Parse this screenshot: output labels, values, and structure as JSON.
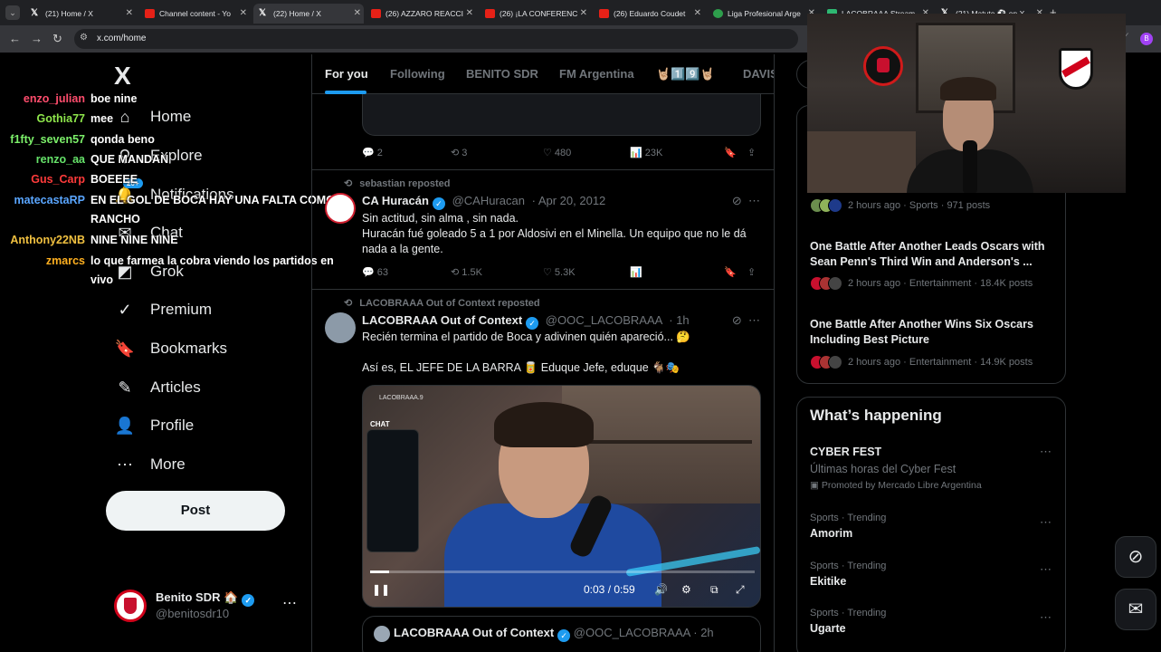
{
  "browser": {
    "tabs": [
      {
        "title": "(21) Home / X",
        "type": "x"
      },
      {
        "title": "Channel content - Yo",
        "type": "yt"
      },
      {
        "title": "(22) Home / X",
        "type": "x",
        "active": true
      },
      {
        "title": "(26) AZZARO REACCI",
        "type": "yt"
      },
      {
        "title": "(26) ¡LA CONFERENC",
        "type": "yt"
      },
      {
        "title": "(26) Eduardo Coudet",
        "type": "yt"
      },
      {
        "title": "Liga Profesional Arge",
        "type": "liga"
      },
      {
        "title": "LACOBRAAA Stream",
        "type": "twitch"
      },
      {
        "title": "(21) Matute ⚽ on X",
        "type": "x"
      }
    ],
    "url": "x.com/home",
    "profile_initial": "B"
  },
  "sidebar": {
    "logo": "X",
    "items": [
      {
        "label": "Home",
        "icon": "home-icon",
        "glyph": "⌂"
      },
      {
        "label": "Explore",
        "icon": "search-icon",
        "glyph": "⚲"
      },
      {
        "label": "Notifications",
        "icon": "bell-icon",
        "glyph": "🔔",
        "badge": "20+"
      },
      {
        "label": "Chat",
        "icon": "chat-icon",
        "glyph": "✉"
      },
      {
        "label": "Grok",
        "icon": "grok-icon",
        "glyph": "◩"
      },
      {
        "label": "Premium",
        "icon": "premium-icon",
        "glyph": "✓"
      },
      {
        "label": "Bookmarks",
        "icon": "bookmark-icon",
        "glyph": "🔖"
      },
      {
        "label": "Articles",
        "icon": "articles-icon",
        "glyph": "✎"
      },
      {
        "label": "Profile",
        "icon": "profile-icon",
        "glyph": "👤"
      },
      {
        "label": "More",
        "icon": "more-icon",
        "glyph": "⋯"
      }
    ],
    "post_label": "Post",
    "account": {
      "name": "Benito SDR 🏠",
      "handle": "@benitosdr10"
    }
  },
  "chat": [
    {
      "user": "enzo_julian",
      "color": "#ff4d6d",
      "msg": "boe nine"
    },
    {
      "user": "Gothia77",
      "color": "#8ee64b",
      "msg": "mee"
    },
    {
      "user": "f1fty_seven57",
      "color": "#7cf06a",
      "msg": "qonda beno"
    },
    {
      "user": "renzo_aa",
      "color": "#66e36a",
      "msg": "QUE MANDAN"
    },
    {
      "user": "Gus_Carp",
      "color": "#ff3b3b",
      "msg": "BOEEEE"
    },
    {
      "user": "matecastaRP",
      "color": "#5aa6ff",
      "msg": "EN EL GOL DE BOCA HAY UNA FALTA COMO"
    },
    {
      "user": "",
      "color": "#ffffff",
      "msg": "RANCHO"
    },
    {
      "user": "Anthony22NB",
      "color": "#f0c040",
      "msg": "NINE NINE NINE"
    },
    {
      "user": "zmarcs",
      "color": "#ffb020",
      "msg": "lo que farmea la cobra viendo los partidos en"
    },
    {
      "user": "",
      "color": "#ffffff",
      "msg": "vivo"
    }
  ],
  "feed": {
    "tabs": [
      "For you",
      "Following",
      "BENITO SDR",
      "FM Argentina",
      "🤘🏼1️⃣9️⃣🤘🏼",
      "DAVIS"
    ],
    "tweet1": {
      "replies": "2",
      "reposts": "3",
      "likes": "480",
      "views": "23K"
    },
    "tweet2": {
      "repost_by": "sebastian reposted",
      "name": "CA Huracán",
      "handle": "@CAHuracan",
      "date": "Apr 20, 2012",
      "text1": "Sin actitud, sin alma , sin nada.",
      "text2": "Huracán fué goleado 5 a 1 por Aldosivi en el Minella. Un equipo que no le dá nada a la gente.",
      "replies": "63",
      "reposts": "1.5K",
      "likes": "5.3K"
    },
    "tweet3": {
      "repost_by": "LACOBRAAA Out of Context reposted",
      "name": "LACOBRAAA Out of Context",
      "handle": "@OOC_LACOBRAAA",
      "date": "1h",
      "text1": "Recién termina el partido de Boca y adivinen quién apareció... 🤔",
      "text2": "Así es, EL JEFE DE LA BARRA 🥫 Eduque Jefe, eduque 🐐🎭",
      "video_time": "0:03 / 0:59",
      "video_progress": 0.05,
      "video_brand": "LACOBRAAA.9",
      "video_chat_label": "CHAT"
    },
    "quote": {
      "name": "LACOBRAAA Out of Context",
      "handle": "@OOC_LACOBRAAA",
      "date": "2h"
    }
  },
  "right": {
    "news": [
      {
        "meta": "2 hours ago · Sports · 971 posts",
        "title": ""
      },
      {
        "title": "One Battle After Another Leads Oscars with Sean Penn's Third Win and Anderson's ...",
        "meta": "2 hours ago · Entertainment · 18.4K posts"
      },
      {
        "title": "One Battle After Another Wins Six Oscars Including Best Picture",
        "meta": "2 hours ago · Entertainment · 14.9K posts"
      }
    ],
    "whats_happening": {
      "title": "What’s happening",
      "promo": {
        "name": "CYBER FEST",
        "desc": "Últimas horas del Cyber Fest",
        "by": "Promoted by Mercado Libre Argentina"
      },
      "trends": [
        {
          "context": "Sports · Trending",
          "name": "Amorim"
        },
        {
          "context": "Sports · Trending",
          "name": "Ekitike"
        },
        {
          "context": "Sports · Trending",
          "name": "Ugarte"
        }
      ]
    }
  }
}
